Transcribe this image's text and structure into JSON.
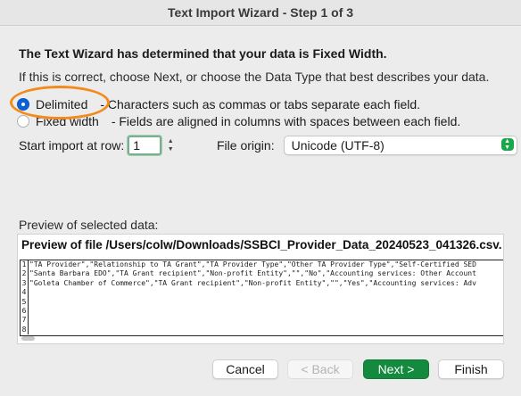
{
  "window": {
    "title": "Text Import Wizard - Step 1 of 3"
  },
  "heading": "The Text Wizard has determined that your data is Fixed Width.",
  "subtext": "If this is correct, choose Next, or choose the Data Type that best describes your data.",
  "data_type": {
    "options": [
      {
        "label": "Delimited",
        "description": "- Characters such as commas or tabs separate each field.",
        "selected": true
      },
      {
        "label": "Fixed width",
        "description": "- Fields are aligned in columns with spaces between each field.",
        "selected": false
      }
    ]
  },
  "start_import": {
    "label": "Start import at row:",
    "value": "1"
  },
  "file_origin": {
    "label": "File origin:",
    "value": "Unicode (UTF-8)"
  },
  "preview": {
    "label": "Preview of selected data:",
    "file_title": "Preview of file /Users/colw/Downloads/SSBCI_Provider_Data_20240523_041326.csv.",
    "rows": [
      {
        "num": "1",
        "text": "\"TA Provider\",\"Relationship to TA Grant\",\"TA Provider Type\",\"Other TA Provider Type\",\"Self-Certified SED"
      },
      {
        "num": "2",
        "text": "\"Santa Barbara EDO\",\"TA Grant recipient\",\"Non-profit Entity\",\"\",\"No\",\"Accounting services: Other Account"
      },
      {
        "num": "3",
        "text": "\"Goleta Chamber of Commerce\",\"TA Grant recipient\",\"Non-profit Entity\",\"\",\"Yes\",\"Accounting services: Adv"
      },
      {
        "num": "4",
        "text": ""
      },
      {
        "num": "5",
        "text": ""
      },
      {
        "num": "6",
        "text": ""
      },
      {
        "num": "7",
        "text": ""
      },
      {
        "num": "8",
        "text": ""
      }
    ]
  },
  "buttons": {
    "cancel": "Cancel",
    "back": "< Back",
    "next": "Next >",
    "finish": "Finish"
  },
  "colors": {
    "accent_green": "#148a3e",
    "radio_blue": "#0a63d6",
    "highlight_orange": "#f28a1e"
  }
}
